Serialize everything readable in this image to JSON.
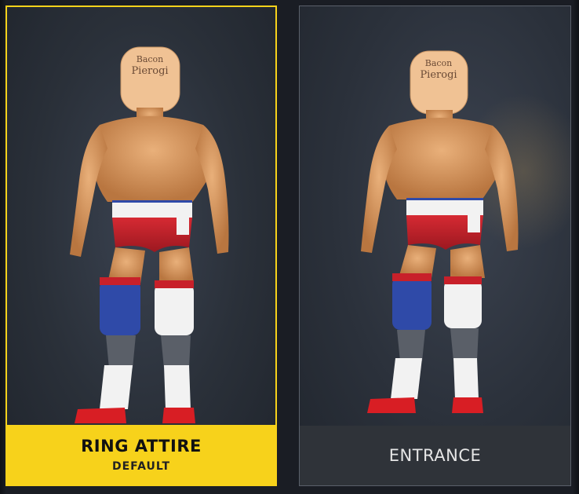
{
  "cards": [
    {
      "title": "RING ATTIRE",
      "subtitle": "DEFAULT",
      "selected": true,
      "head_text_line1": "Bacon",
      "head_text_line2": "Pierogi"
    },
    {
      "title": "ENTRANCE",
      "subtitle": "",
      "selected": false,
      "head_text_line1": "Bacon",
      "head_text_line2": "Pierogi"
    }
  ],
  "colors": {
    "selected_accent": "#f7d21b",
    "unselected_bar": "#2f3339",
    "skin": "#d99a5c",
    "trunks_red": "#c8202a",
    "trunks_white": "#f2f2f2",
    "kneepad_blue": "#2f4aa8",
    "boot_red": "#d81e24"
  },
  "icons": [
    "wrestler-model"
  ]
}
